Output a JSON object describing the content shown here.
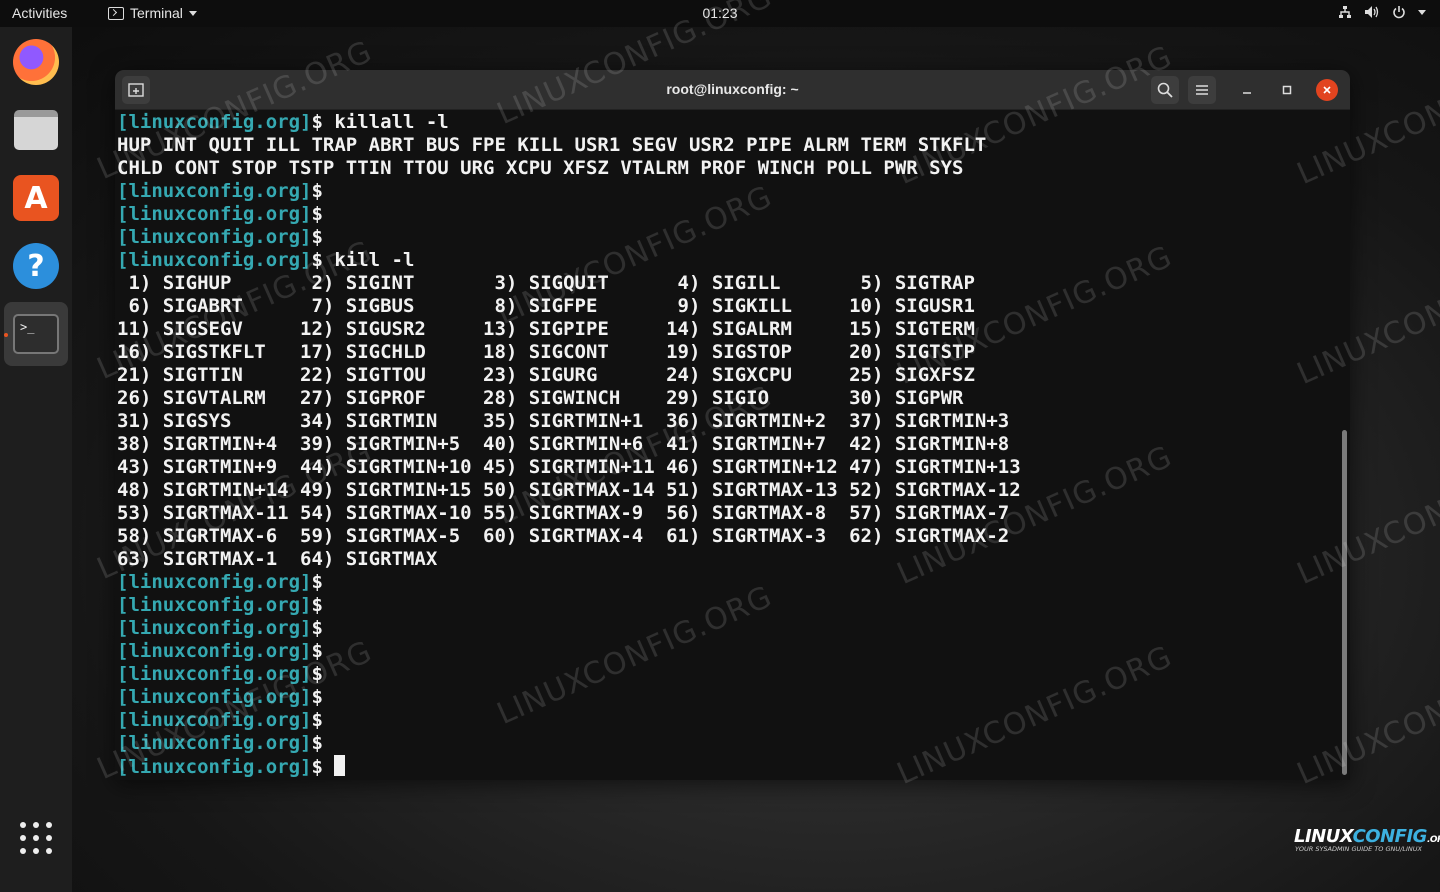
{
  "topbar": {
    "activities": "Activities",
    "app_name": "Terminal",
    "clock": "01:23",
    "tray_icons": [
      "network-icon",
      "volume-icon",
      "power-icon",
      "chevron-down-icon"
    ]
  },
  "dock": {
    "items": [
      "firefox",
      "files",
      "ubuntu-software",
      "help",
      "terminal"
    ],
    "active": "terminal",
    "show_apps_icon": "apps-grid-icon"
  },
  "window": {
    "title": "root@linuxconfig: ~",
    "buttons": [
      "new-tab",
      "search",
      "menu",
      "minimize",
      "maximize",
      "close"
    ]
  },
  "terminal": {
    "prompt": "[linuxconfig.org]",
    "prompt_color": "#35a9b2",
    "lines": [
      {
        "prompt": true,
        "text": "$ killall -l"
      },
      {
        "prompt": false,
        "text": "HUP INT QUIT ILL TRAP ABRT BUS FPE KILL USR1 SEGV USR2 PIPE ALRM TERM STKFLT"
      },
      {
        "prompt": false,
        "text": "CHLD CONT STOP TSTP TTIN TTOU URG XCPU XFSZ VTALRM PROF WINCH POLL PWR SYS"
      },
      {
        "prompt": true,
        "text": "$"
      },
      {
        "prompt": true,
        "text": "$"
      },
      {
        "prompt": true,
        "text": "$"
      },
      {
        "prompt": true,
        "text": "$ kill -l"
      },
      {
        "prompt": false,
        "text": " 1) SIGHUP       2) SIGINT       3) SIGQUIT      4) SIGILL       5) SIGTRAP"
      },
      {
        "prompt": false,
        "text": " 6) SIGABRT      7) SIGBUS       8) SIGFPE       9) SIGKILL     10) SIGUSR1"
      },
      {
        "prompt": false,
        "text": "11) SIGSEGV     12) SIGUSR2     13) SIGPIPE     14) SIGALRM     15) SIGTERM"
      },
      {
        "prompt": false,
        "text": "16) SIGSTKFLT   17) SIGCHLD     18) SIGCONT     19) SIGSTOP     20) SIGTSTP"
      },
      {
        "prompt": false,
        "text": "21) SIGTTIN     22) SIGTTOU     23) SIGURG      24) SIGXCPU     25) SIGXFSZ"
      },
      {
        "prompt": false,
        "text": "26) SIGVTALRM   27) SIGPROF     28) SIGWINCH    29) SIGIO       30) SIGPWR"
      },
      {
        "prompt": false,
        "text": "31) SIGSYS      34) SIGRTMIN    35) SIGRTMIN+1  36) SIGRTMIN+2  37) SIGRTMIN+3"
      },
      {
        "prompt": false,
        "text": "38) SIGRTMIN+4  39) SIGRTMIN+5  40) SIGRTMIN+6  41) SIGRTMIN+7  42) SIGRTMIN+8"
      },
      {
        "prompt": false,
        "text": "43) SIGRTMIN+9  44) SIGRTMIN+10 45) SIGRTMIN+11 46) SIGRTMIN+12 47) SIGRTMIN+13"
      },
      {
        "prompt": false,
        "text": "48) SIGRTMIN+14 49) SIGRTMIN+15 50) SIGRTMAX-14 51) SIGRTMAX-13 52) SIGRTMAX-12"
      },
      {
        "prompt": false,
        "text": "53) SIGRTMAX-11 54) SIGRTMAX-10 55) SIGRTMAX-9  56) SIGRTMAX-8  57) SIGRTMAX-7"
      },
      {
        "prompt": false,
        "text": "58) SIGRTMAX-6  59) SIGRTMAX-5  60) SIGRTMAX-4  61) SIGRTMAX-3  62) SIGRTMAX-2"
      },
      {
        "prompt": false,
        "text": "63) SIGRTMAX-1  64) SIGRTMAX"
      },
      {
        "prompt": true,
        "text": "$"
      },
      {
        "prompt": true,
        "text": "$"
      },
      {
        "prompt": true,
        "text": "$"
      },
      {
        "prompt": true,
        "text": "$"
      },
      {
        "prompt": true,
        "text": "$"
      },
      {
        "prompt": true,
        "text": "$"
      },
      {
        "prompt": true,
        "text": "$"
      },
      {
        "prompt": true,
        "text": "$"
      },
      {
        "prompt": true,
        "text": "$",
        "cursor": true
      }
    ]
  },
  "watermark": "LINUXCONFIG.ORG",
  "brand": {
    "name_a": "LINUX",
    "name_b": "CONFIG",
    "suffix": ".ORG",
    "tagline": "YOUR SYSADMIN GUIDE TO GNU/LINUX"
  },
  "colors": {
    "accent": "#e95420",
    "close_button": "#e2441f",
    "terminal_bg": "#111111",
    "terminal_fg": "#f2f2f2"
  }
}
